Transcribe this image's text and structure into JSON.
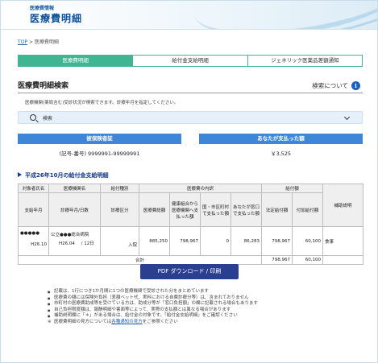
{
  "header": {
    "subtitle": "医療費情報",
    "title": "医療費明細"
  },
  "breadcrumb": {
    "top": "TOP",
    "separator": ">",
    "current": "医療費明細"
  },
  "tabs": [
    {
      "label": "医療費明細",
      "active": true
    },
    {
      "label": "給付金支給明細",
      "active": false
    },
    {
      "label": "ジェネリック医薬品差額通知",
      "active": false
    }
  ],
  "search_section": {
    "title": "医療費明細検索",
    "about_label": "検索について",
    "description": "医療機関(薬局含む)受診状況が検索できます。診療年月を指定してください。",
    "search_label": "検索"
  },
  "insured": {
    "label": "被保険者証",
    "value": "(記号-番号) 9999991-99999991"
  },
  "paid": {
    "label": "あなたが支払った額",
    "value": "￥3,525"
  },
  "detail_title": "平成26年10月の給付金支給明細",
  "table": {
    "headers": {
      "target": "対象者氏名",
      "institution": "医療機関名",
      "benefit_type": "給付種別",
      "medical_breakdown": "医療費の内訳",
      "benefit_amount": "給付額",
      "payment_month": "支給年月",
      "visit_date": "診療年月/日数",
      "medical_category": "診療区分",
      "total_medical": "医療費総額",
      "health_ins": "健康組合から医療機関へ支払った額",
      "city": "国・市区町村で支払った額",
      "you_paid": "あなたが窓口で支払った額",
      "statutory": "法定給付額",
      "additional": "付加給付額",
      "supplement": "補助説明"
    },
    "row": {
      "name": "●●●●●",
      "payment_month": "H26.10",
      "institution": "公立●●●総合病院",
      "visit_month": "H26.04",
      "slash": "/",
      "days": "12日",
      "category": "入院",
      "total": "885,250",
      "health_ins": "798,967",
      "city": "0",
      "you_paid": "86,283",
      "statutory": "798,967",
      "additional": "60,100",
      "supplement": "食事"
    },
    "total_row": {
      "label": "合計",
      "statutory": "798,967",
      "additional": "60,100"
    }
  },
  "pdf_button": "PDF ダウンロード / 印刷",
  "notes": [
    "記載は、1行につき1か月間に1つの医療機関で受診された分をまとめています",
    "医療費の額には保険外負担（差額ベット代、実料における自費診療分等）は、含まれておりません",
    "市町村の医療費助成等を受けている方は、助成分等が「窓口負担額」の欄に記載される場合もあります",
    "自己負担限度額は、報酬明細や書面等によって、実際の支払額とは異なる場合があります",
    "補助説明欄に「＊」がある場合は、給付金の対象です。「給付金支給明細」をご確認ください"
  ],
  "ref_note": {
    "before": "医療費明細の見方については",
    "link": "各種通知の見方",
    "after": "をご参照ください"
  },
  "colors": {
    "brand_navy": "#0e4f98",
    "tab_green": "#3fb591",
    "label_blue": "#3d86d8",
    "button_navy": "#2b3f91",
    "search_bg": "#e6f0fb"
  },
  "icons": {
    "about": "info-circle-icon",
    "search": "search-icon",
    "expand": "chevron-down-icon",
    "section": "triangle-right-icon"
  }
}
